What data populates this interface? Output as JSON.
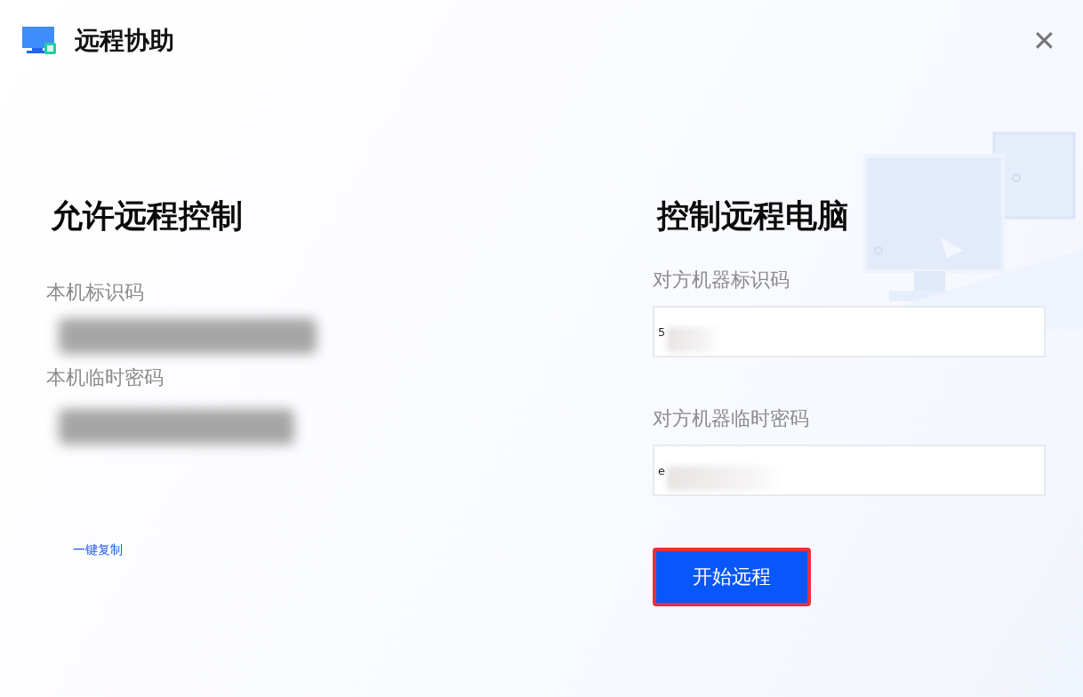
{
  "window": {
    "title": "远程协助",
    "close": "✕"
  },
  "allow": {
    "heading": "允许远程控制",
    "id_label": "本机标识码",
    "password_label": "本机临时密码",
    "copy_link": "一键复制"
  },
  "control": {
    "heading": "控制远程电脑",
    "id_label": "对方机器标识码",
    "id_value": "5",
    "password_label": "对方机器临时密码",
    "password_value": "e",
    "button": {
      "label": "开始远程",
      "highlighted": true
    }
  }
}
